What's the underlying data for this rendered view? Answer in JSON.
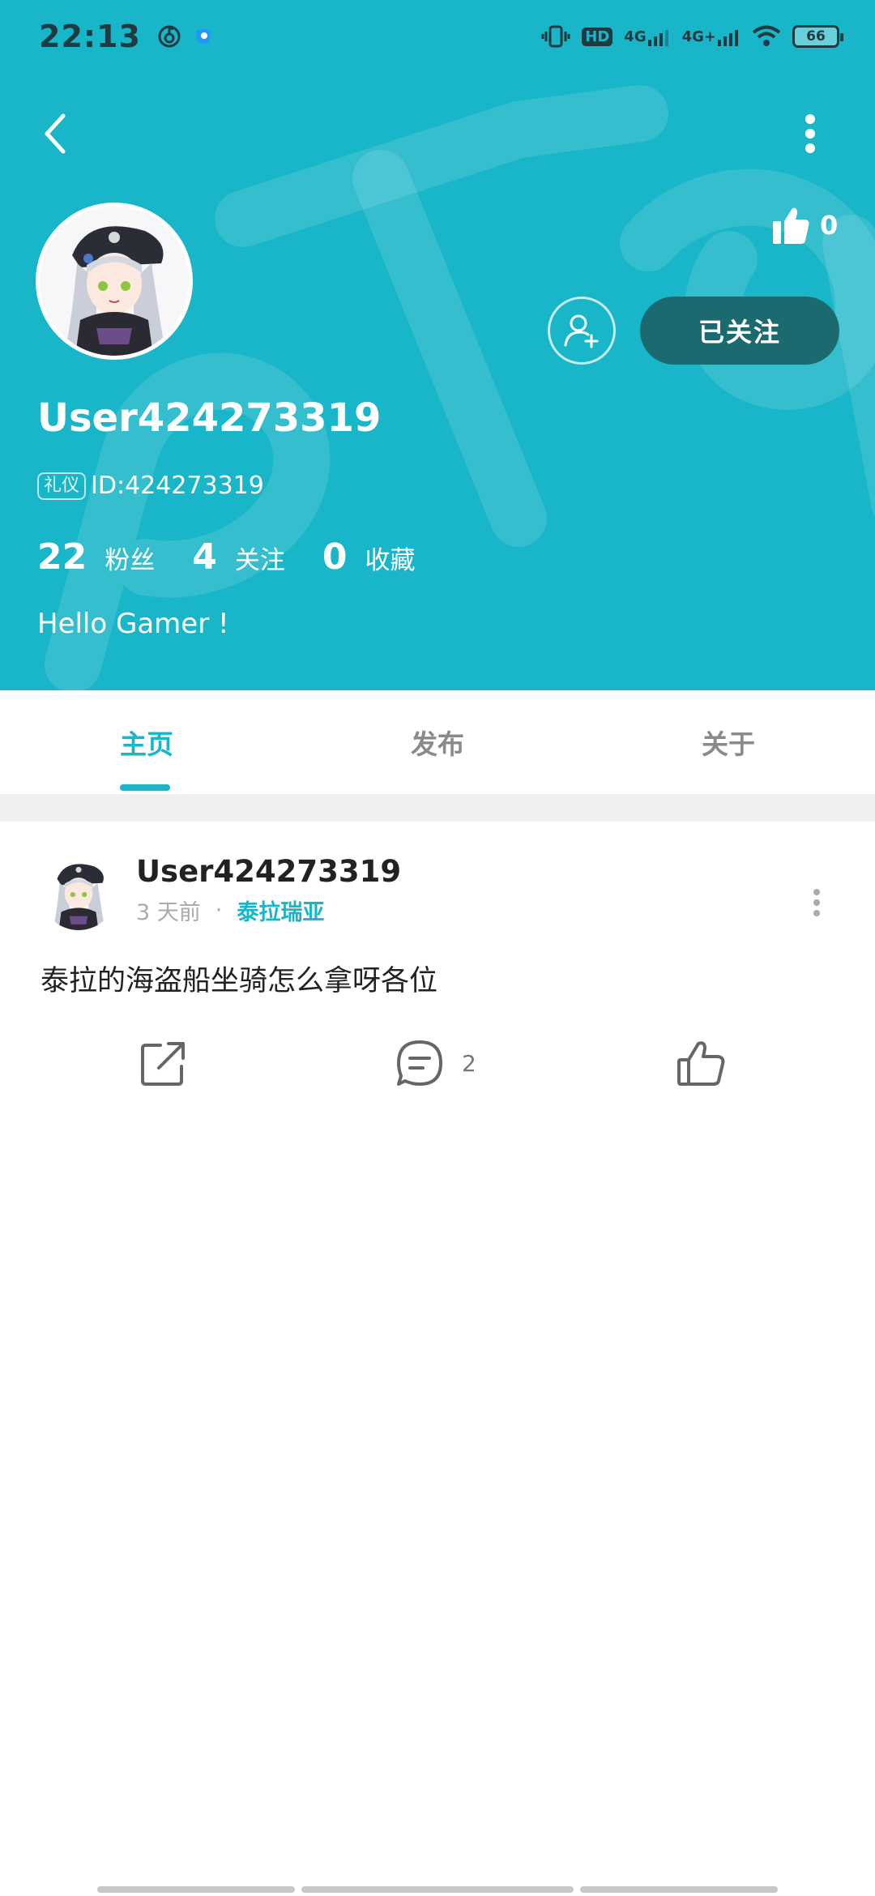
{
  "status_bar": {
    "time": "22:13",
    "left_icons": [
      "netease-music-icon",
      "app-notification-icon"
    ],
    "right_icons": [
      "vibrate-icon",
      "hd-icon",
      "signal-4g-icon",
      "signal-4g-plus-icon",
      "wifi-icon"
    ],
    "hd_label": "HD",
    "network1": "4G",
    "network2": "4G+",
    "battery": "66"
  },
  "header": {
    "background_color": "#18b6c8",
    "like_count": "0",
    "follow_button": "已关注",
    "username": "User424273319",
    "id_badge": "礼仪",
    "id_text": "ID:424273319",
    "stats": [
      {
        "num": "22",
        "label": "粉丝"
      },
      {
        "num": "4",
        "label": "关注"
      },
      {
        "num": "0",
        "label": "收藏"
      }
    ],
    "bio": "Hello Gamer !"
  },
  "tabs": [
    {
      "label": "主页",
      "active": true
    },
    {
      "label": "发布",
      "active": false
    },
    {
      "label": "关于",
      "active": false
    }
  ],
  "post": {
    "author": "User424273319",
    "time": "3 天前",
    "separator": "·",
    "topic": "泰拉瑞亚",
    "text": "泰拉的海盗船坐骑怎么拿呀各位",
    "comment_count": "2"
  },
  "colors": {
    "accent": "#18b6c8",
    "follow_button_bg": "#1a6a70"
  }
}
